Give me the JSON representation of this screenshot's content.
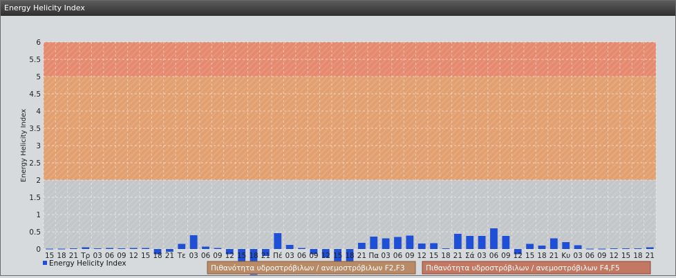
{
  "window": {
    "title": "Energy Helicity Index"
  },
  "chart_data": {
    "type": "bar",
    "ylabel": "Energy Helicity Index",
    "xlabel": "",
    "ylim": [
      0,
      6
    ],
    "yticks": [
      0,
      0.5,
      1,
      1.5,
      2,
      2.5,
      3,
      3.5,
      4,
      4.5,
      5,
      5.5,
      6
    ],
    "ytick_labels": [
      "0",
      "0.5",
      "1",
      "1.5",
      "2",
      "2.5",
      "3",
      "3.5",
      "4",
      "4.5",
      "5",
      "5.5",
      "6"
    ],
    "grid": true,
    "bands": [
      {
        "from": 0,
        "to": 2,
        "color": "#c4c7ca"
      },
      {
        "from": 2,
        "to": 5,
        "color": "#e2a071"
      },
      {
        "from": 5,
        "to": 6,
        "color": "#e58a6f"
      }
    ],
    "categories": [
      "15",
      "18",
      "21",
      "Τρ",
      "03",
      "06",
      "09",
      "12",
      "15",
      "18",
      "21",
      "Τε",
      "03",
      "06",
      "09",
      "12",
      "15",
      "18",
      "21",
      "Πέ",
      "03",
      "06",
      "09",
      "12",
      "15",
      "18",
      "21",
      "Πα",
      "03",
      "06",
      "09",
      "12",
      "15",
      "18",
      "21",
      "Σά",
      "03",
      "06",
      "09",
      "12",
      "15",
      "18",
      "21",
      "Κυ",
      "03",
      "06",
      "09",
      "12",
      "15",
      "18",
      "21"
    ],
    "values": [
      0.01,
      0.01,
      0.02,
      0.05,
      0.02,
      0.03,
      0.02,
      0.03,
      0.03,
      -0.15,
      -0.08,
      0.15,
      0.4,
      0.07,
      0.03,
      -0.15,
      -0.55,
      -0.75,
      -0.2,
      0.46,
      0.12,
      0.03,
      -0.15,
      -0.25,
      -0.55,
      -0.55,
      0.18,
      0.36,
      0.31,
      0.35,
      0.39,
      0.16,
      0.17,
      0.02,
      0.44,
      0.38,
      0.38,
      0.6,
      0.38,
      -0.15,
      0.15,
      0.1,
      0.31,
      0.2,
      0.11,
      0.01,
      0.01,
      0.02,
      0.02,
      0.02,
      0.05
    ],
    "series": [
      {
        "name": "Energy Helicity Index",
        "color": "#1e4fd6"
      }
    ],
    "legend_position": "bottom-left",
    "annotations": [
      "Πιθανότητα υδροστρόβιλων / ανεμοστρόβιλων F2,F3",
      "Πιθανότητα υδροστρόβιλων / ανεμοστρόβιλων F4,F5"
    ]
  }
}
